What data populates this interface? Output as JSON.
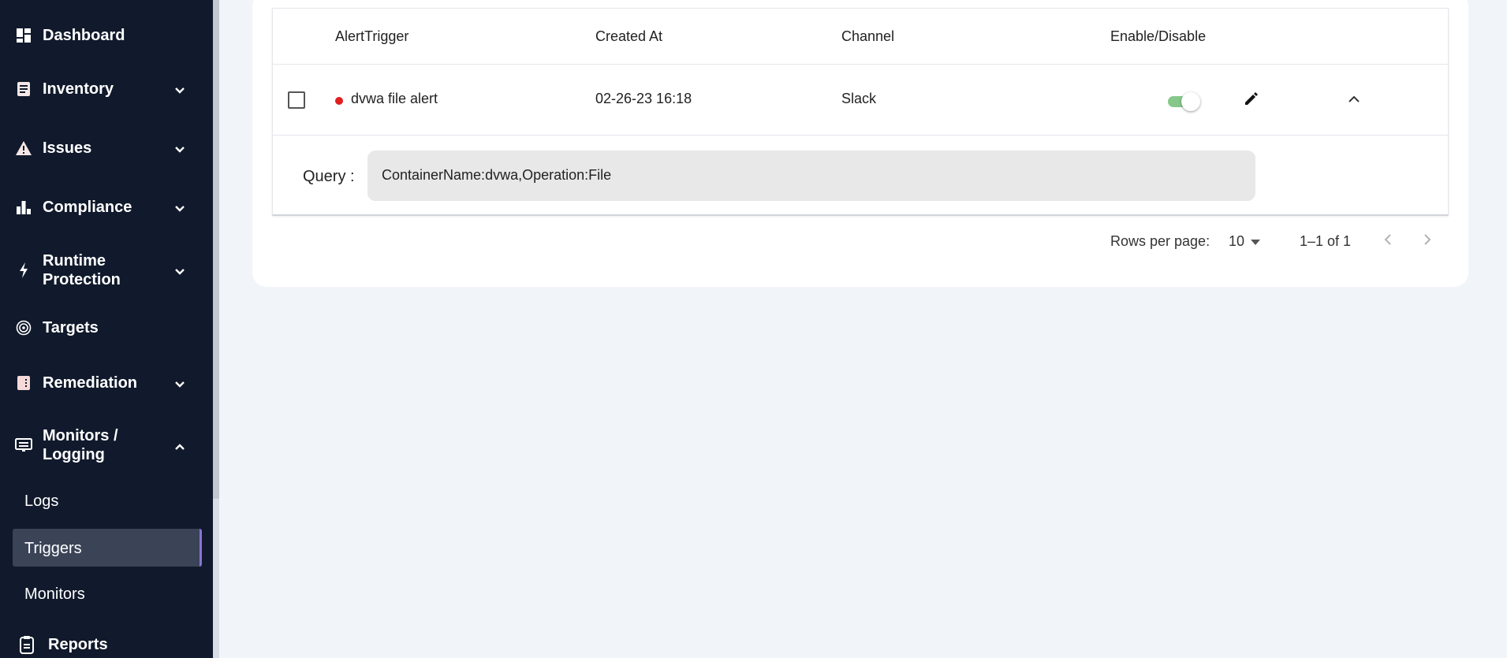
{
  "sidebar": {
    "items": [
      {
        "label": "Dashboard",
        "icon": "dashboard-icon"
      },
      {
        "label": "Inventory",
        "icon": "inventory-icon"
      },
      {
        "label": "Issues",
        "icon": "warning-icon"
      },
      {
        "label": "Compliance",
        "icon": "bar-chart-icon"
      },
      {
        "label": "Runtime Protection",
        "line1": "Runtime",
        "line2": "Protection",
        "icon": "lightning-icon"
      },
      {
        "label": "Targets",
        "icon": "target-icon"
      },
      {
        "label": "Remediation",
        "icon": "remediation-icon"
      },
      {
        "label": "Monitors / Logging",
        "line1": "Monitors /",
        "line2": "Logging",
        "icon": "monitor-icon"
      },
      {
        "label": "Reports",
        "icon": "clipboard-icon"
      }
    ],
    "subitems": [
      {
        "label": "Logs"
      },
      {
        "label": "Triggers",
        "active": true
      },
      {
        "label": "Monitors"
      }
    ]
  },
  "table": {
    "columns": [
      "AlertTrigger",
      "Created At",
      "Channel",
      "Enable/Disable"
    ],
    "rows": [
      {
        "alert_trigger": "dvwa file alert",
        "status_color": "#e02020",
        "created_at": "02-26-23 16:18",
        "channel": "Slack",
        "enabled": true,
        "query_label": "Query :",
        "query": "ContainerName:dvwa,Operation:File"
      }
    ]
  },
  "pagination": {
    "rows_per_page_label": "Rows per page:",
    "rows_per_page": "10",
    "range": "1–1 of 1"
  },
  "colors": {
    "sidebar_bg": "#111a2c",
    "active_item_bg": "#3b4457",
    "active_accent": "#8b73d6",
    "toggle_on": "#86c88a"
  }
}
